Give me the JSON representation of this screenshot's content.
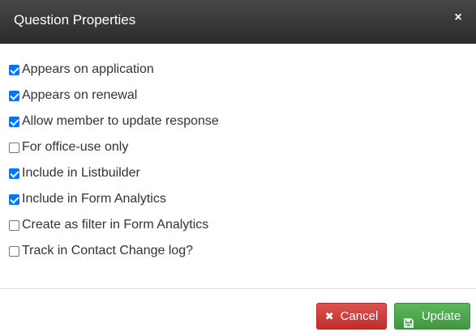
{
  "header": {
    "title": "Question Properties",
    "close_glyph": "×"
  },
  "options": [
    {
      "label": "Appears on application",
      "checked": true
    },
    {
      "label": "Appears on renewal",
      "checked": true
    },
    {
      "label": "Allow member to update response",
      "checked": true
    },
    {
      "label": "For office-use only",
      "checked": false
    },
    {
      "label": "Include in Listbuilder",
      "checked": true
    },
    {
      "label": "Include in Form Analytics",
      "checked": true
    },
    {
      "label": "Create as filter in Form Analytics",
      "checked": false
    },
    {
      "label": "Track in Contact Change log?",
      "checked": false
    }
  ],
  "footer": {
    "cancel_label": "Cancel",
    "cancel_icon": "times-icon",
    "update_label": "Update",
    "update_icon": "save-icon"
  },
  "colors": {
    "header_bg": "#3a3a3a",
    "cancel_bg": "#d9534f",
    "update_bg": "#5cb85c",
    "checkbox_checked": "#0075ff"
  }
}
